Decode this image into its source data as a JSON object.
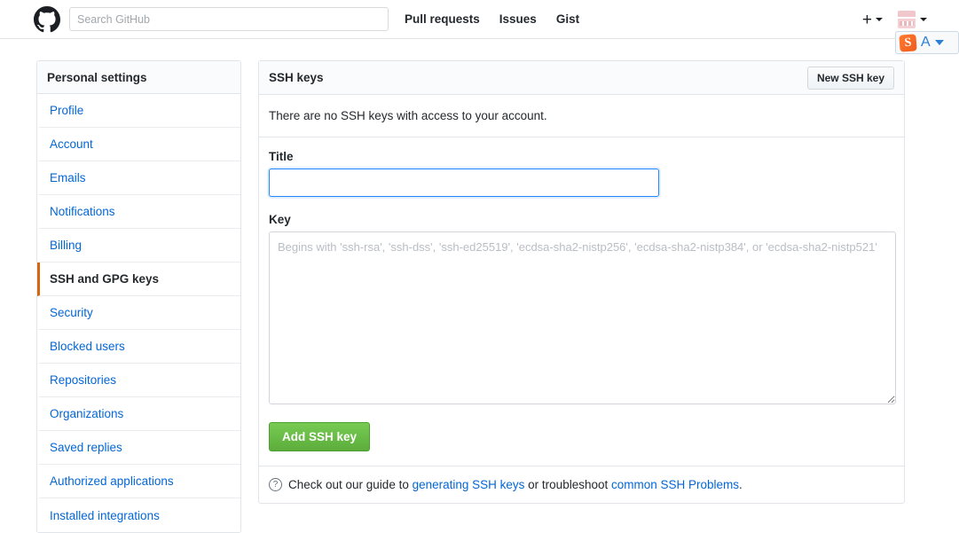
{
  "header": {
    "logo_icon": "github-octocat-icon",
    "search": {
      "placeholder": "Search GitHub",
      "value": ""
    },
    "nav": [
      {
        "label": "Pull requests"
      },
      {
        "label": "Issues"
      },
      {
        "label": "Gist"
      }
    ],
    "create_new": {
      "glyph": "+",
      "icon": "plus-icon",
      "caret_icon": "chevron-down-icon"
    },
    "account": {
      "avatar_icon": "user-avatar",
      "caret_icon": "chevron-down-icon"
    }
  },
  "ime_overlay": {
    "logo_letter": "S",
    "mode_letter": "A",
    "caret_icon": "triangle-down-icon"
  },
  "sidebar": {
    "title": "Personal settings",
    "items": [
      {
        "label": "Profile",
        "selected": false
      },
      {
        "label": "Account",
        "selected": false
      },
      {
        "label": "Emails",
        "selected": false
      },
      {
        "label": "Notifications",
        "selected": false
      },
      {
        "label": "Billing",
        "selected": false
      },
      {
        "label": "SSH and GPG keys",
        "selected": true
      },
      {
        "label": "Security",
        "selected": false
      },
      {
        "label": "Blocked users",
        "selected": false
      },
      {
        "label": "Repositories",
        "selected": false
      },
      {
        "label": "Organizations",
        "selected": false
      },
      {
        "label": "Saved replies",
        "selected": false
      },
      {
        "label": "Authorized applications",
        "selected": false
      },
      {
        "label": "Installed integrations",
        "selected": false
      }
    ]
  },
  "main": {
    "panel_title": "SSH keys",
    "new_key_button": "New SSH key",
    "empty_message": "There are no SSH keys with access to your account.",
    "title_field": {
      "label": "Title",
      "value": "",
      "placeholder": ""
    },
    "key_field": {
      "label": "Key",
      "value": "",
      "placeholder": "Begins with 'ssh-rsa', 'ssh-dss', 'ssh-ed25519', 'ecdsa-sha2-nistp256', 'ecdsa-sha2-nistp384', or 'ecdsa-sha2-nistp521'"
    },
    "submit_button": "Add SSH key",
    "footer": {
      "help_icon": "question-circle-icon",
      "text_before": "Check out our guide to ",
      "link1": "generating SSH keys",
      "text_middle": " or troubleshoot ",
      "link2": "common SSH Problems",
      "text_after": "."
    }
  },
  "colors": {
    "link": "#0366d6",
    "accent_selected": "#d26911",
    "button_green": "#6cc644",
    "focus_blue": "#2188ff",
    "text": "#24292e"
  }
}
